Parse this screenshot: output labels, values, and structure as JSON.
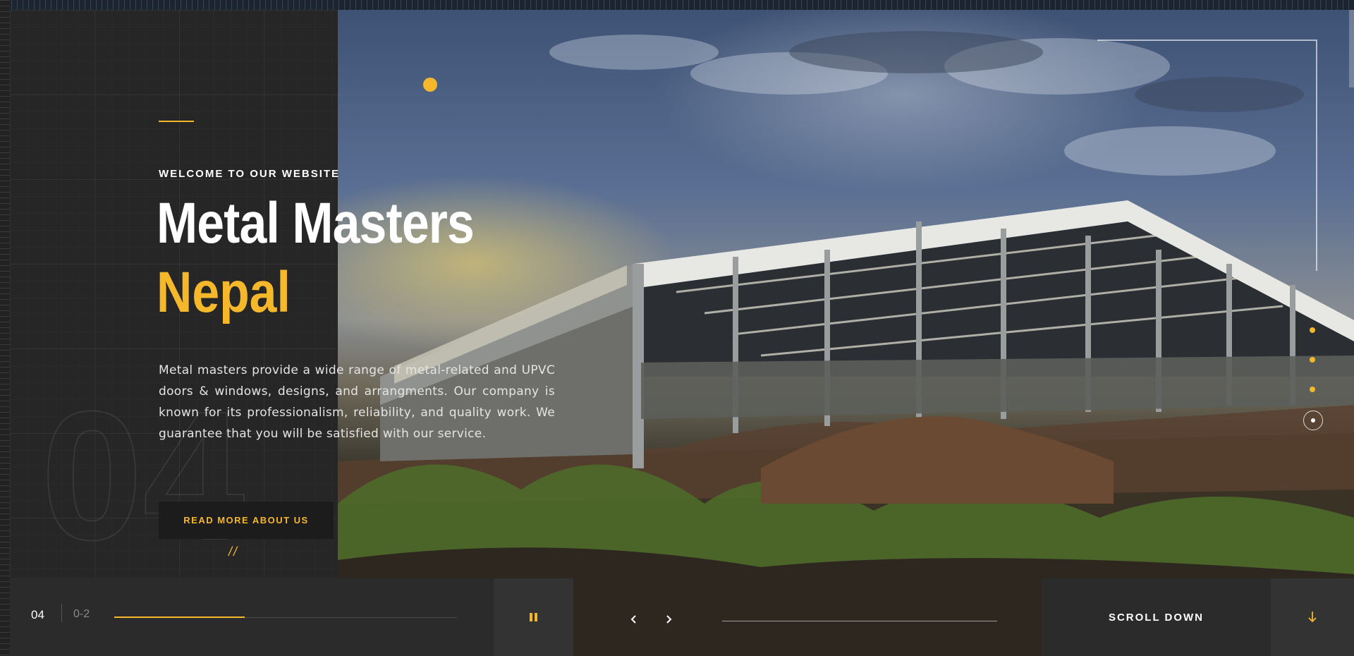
{
  "hero": {
    "eyebrow": "WELCOME TO OUR WEBSITE",
    "title_line1": "Metal Masters",
    "title_line2": "Nepal",
    "description": "Metal masters provide a wide range of metal-related and UPVC doors & windows, designs, and arrangments. Our company is known for its professionalism, reliability, and quality work. We guarantee that you will be satisfied with our service.",
    "background_number": "04",
    "cta_label": "READ MORE ABOUT US",
    "decor_slashes": "//"
  },
  "slider": {
    "current": "04",
    "total": "0-2",
    "progress": 0.38,
    "pause_icon": "pause-icon",
    "prev_icon": "chevron-left-icon",
    "next_icon": "chevron-right-icon",
    "dots": 4,
    "active_dot": 4
  },
  "scroll": {
    "label": "SCROLL DOWN",
    "icon": "arrow-down-icon"
  },
  "colors": {
    "accent": "#f5b82a",
    "panel": "#262626",
    "bar": "#2b2b2b"
  }
}
